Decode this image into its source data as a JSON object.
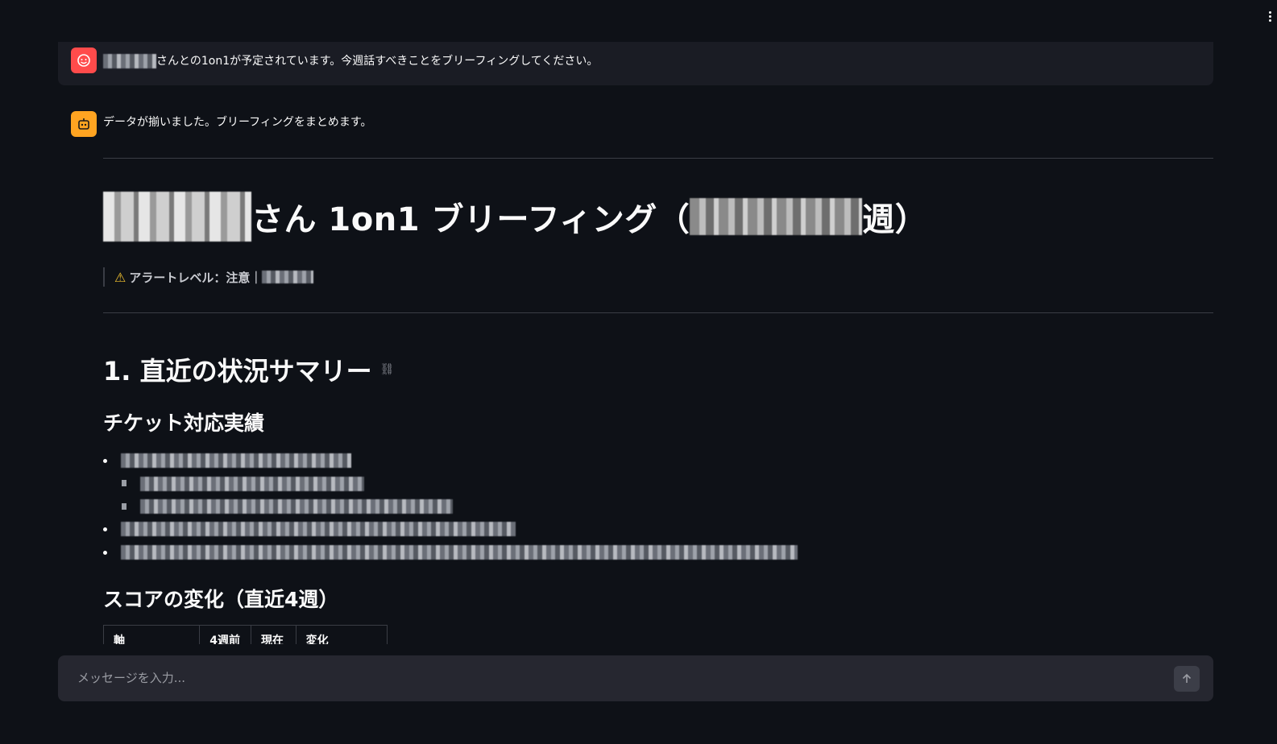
{
  "chat": {
    "user_message": {
      "text": "さんとの1on1が予定されています。今週話すべきことをブリーフィングしてください。",
      "avatar_icon": "face-icon",
      "avatar_color": "#ff4b4b"
    },
    "assistant_message": {
      "text": "データが揃いました。ブリーフィングをまとめます。",
      "avatar_icon": "robot-icon",
      "avatar_color": "#ffa421"
    }
  },
  "briefing": {
    "title_suffix": "さん 1on1 ブリーフィング（",
    "title_end": "週）",
    "alert_icon": "warning-icon",
    "alert_text": "アラートレベル：注意｜",
    "section1_title": "1. 直近の状況サマリー",
    "subsection_tickets": "チケット対応実績",
    "subsection_scores": "スコアの変化（直近4週）",
    "score_table_headers": [
      "軸",
      "4週前",
      "現在",
      "変化"
    ]
  },
  "input": {
    "placeholder": "メッセージを入力...",
    "send_icon": "arrow-up-icon"
  },
  "colors": {
    "background": "#0e1117",
    "user_msg_bg": "#1a1c24",
    "input_bg": "#262730",
    "warning": "#f0c02f"
  }
}
